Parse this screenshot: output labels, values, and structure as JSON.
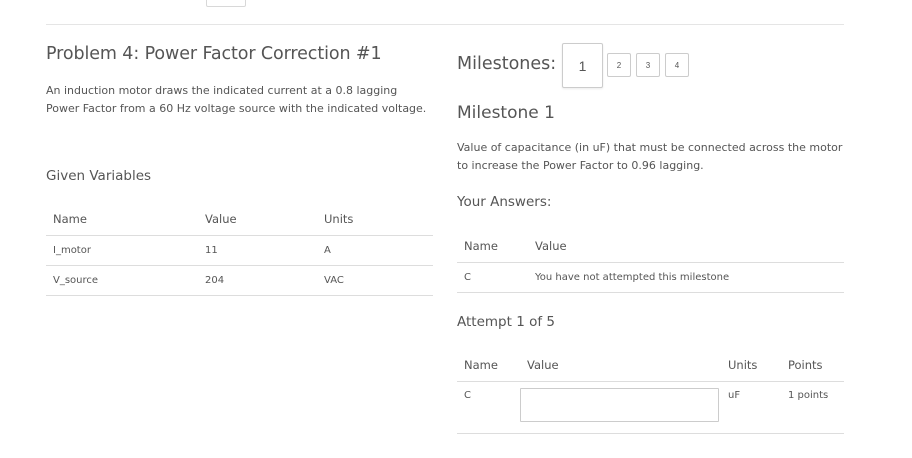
{
  "problem": {
    "title": "Problem 4: Power Factor Correction #1",
    "description": "An induction motor draws the indicated current at a 0.8 lagging Power Factor from a 60 Hz voltage source with the indicated voltage."
  },
  "given": {
    "title": "Given Variables",
    "headers": {
      "name": "Name",
      "value": "Value",
      "units": "Units"
    },
    "rows": [
      {
        "name": "I_motor",
        "value": "11",
        "units": "A"
      },
      {
        "name": "V_source",
        "value": "204",
        "units": "VAC"
      }
    ]
  },
  "milestones": {
    "label": "Milestones:",
    "buttons": [
      "1",
      "2",
      "3",
      "4"
    ],
    "active": "1"
  },
  "milestone": {
    "title": "Milestone 1",
    "description": "Value of capacitance (in uF) that must be connected across the motor to increase the Power Factor to 0.96 lagging."
  },
  "answers": {
    "title": "Your Answers:",
    "headers": {
      "name": "Name",
      "value": "Value"
    },
    "rows": [
      {
        "name": "C",
        "value": "You have not attempted this milestone"
      }
    ]
  },
  "attempt": {
    "title": "Attempt 1 of 5",
    "headers": {
      "name": "Name",
      "value": "Value",
      "units": "Units",
      "points": "Points"
    },
    "row": {
      "name": "C",
      "input_value": "",
      "units": "uF",
      "points": "1 points"
    }
  }
}
